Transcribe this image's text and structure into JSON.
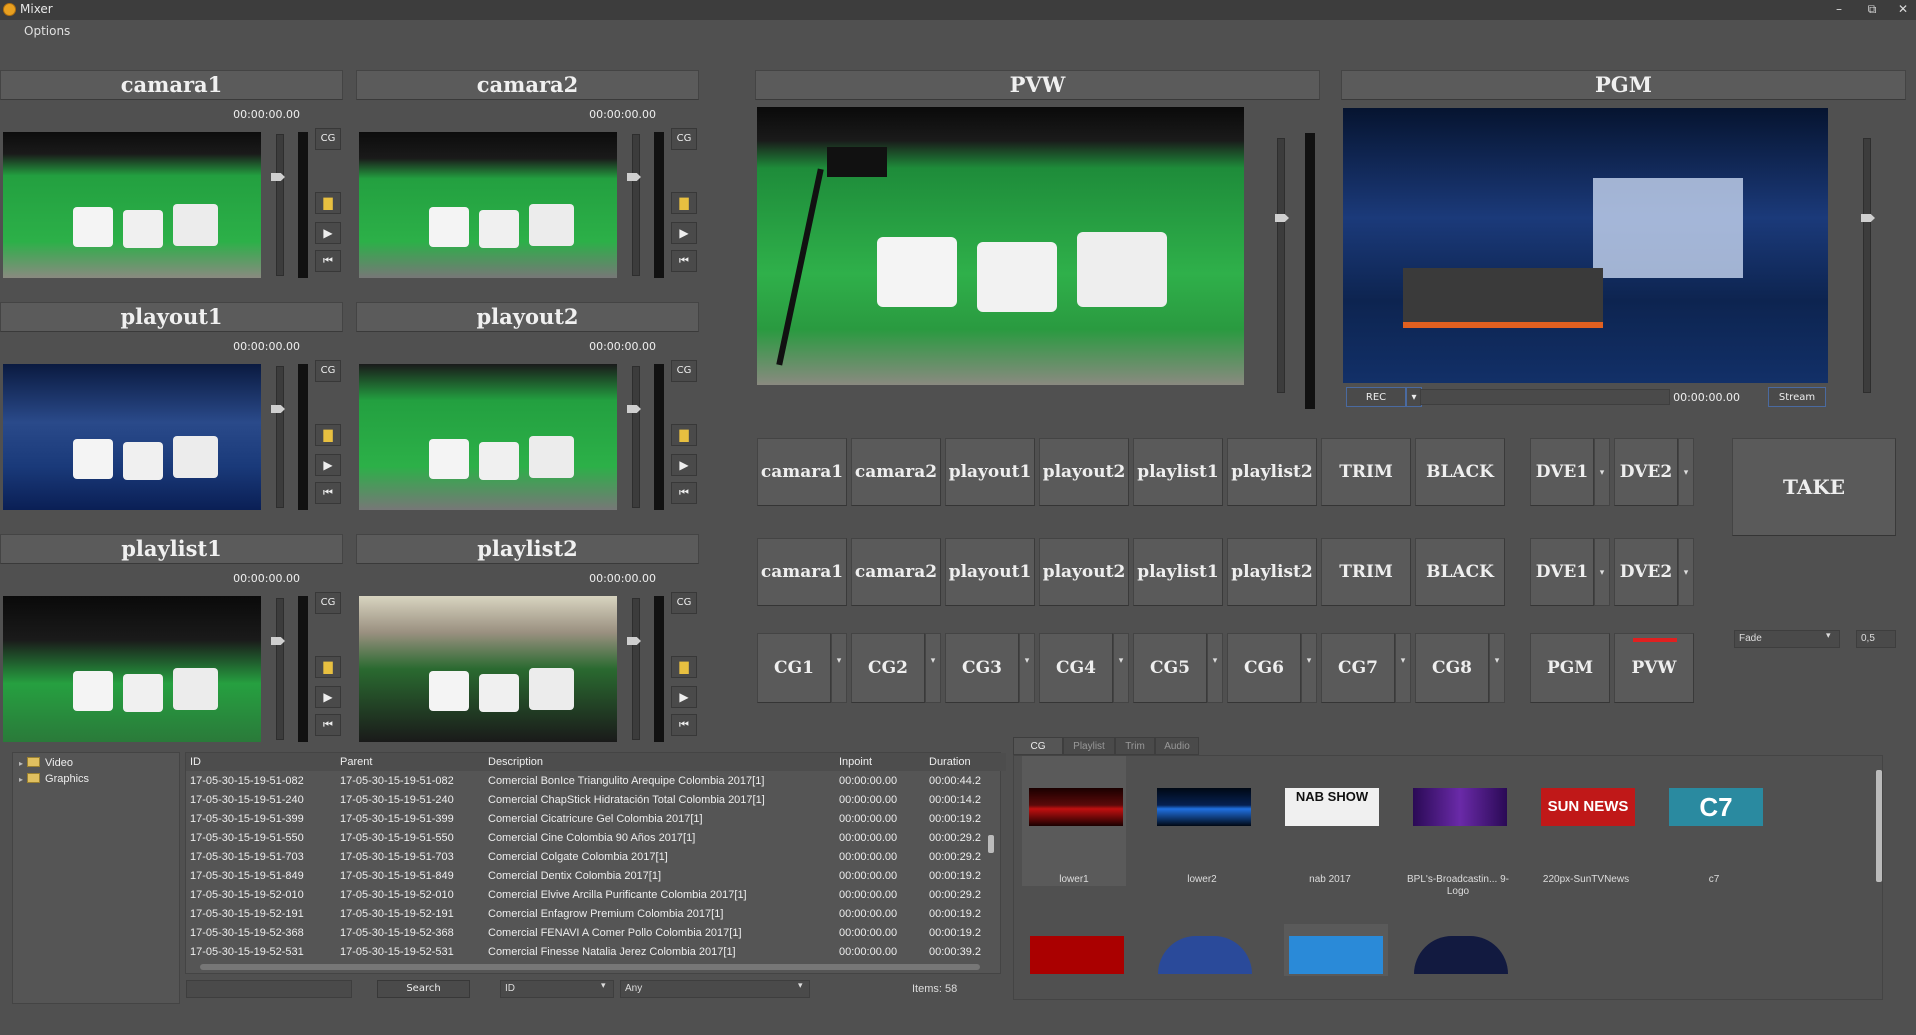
{
  "window": {
    "title": "Mixer",
    "controls": [
      "–",
      "⧉",
      "✕"
    ]
  },
  "menu": {
    "options": "Options"
  },
  "sources": [
    {
      "name": "camara1",
      "time": "00:00:00.00",
      "cg": "CG"
    },
    {
      "name": "camara2",
      "time": "00:00:00.00",
      "cg": "CG"
    },
    {
      "name": "playout1",
      "time": "00:00:00.00",
      "cg": "CG"
    },
    {
      "name": "playout2",
      "time": "00:00:00.00",
      "cg": "CG"
    },
    {
      "name": "playlist1",
      "time": "00:00:00.00",
      "cg": "CG"
    },
    {
      "name": "playlist2",
      "time": "00:00:00.00",
      "cg": "CG"
    }
  ],
  "pvw": {
    "label": "PVW"
  },
  "pgm": {
    "label": "PGM",
    "rec": "REC",
    "time": "00:00:00.00",
    "stream": "Stream"
  },
  "bus_row1": [
    "camara1",
    "camara2",
    "playout1",
    "playout2",
    "playlist1",
    "playlist2",
    "TRIM",
    "BLACK"
  ],
  "bus_row2": [
    "camara1",
    "camara2",
    "playout1",
    "playout2",
    "playlist1",
    "playlist2",
    "TRIM",
    "BLACK"
  ],
  "dve": {
    "dve1": "DVE1",
    "dve2": "DVE2"
  },
  "cg_row": [
    "CG1",
    "CG2",
    "CG3",
    "CG4",
    "CG5",
    "CG6",
    "CG7",
    "CG8"
  ],
  "out": {
    "pgm": "PGM",
    "pvw": "PVW",
    "take": "TAKE"
  },
  "transition": {
    "type": "Fade",
    "duration": "0,5"
  },
  "tree": {
    "video": "Video",
    "graphics": "Graphics"
  },
  "table": {
    "columns": [
      "ID",
      "Parent",
      "Description",
      "Inpoint",
      "Duration"
    ],
    "rows": [
      [
        "17-05-30-15-19-51-082",
        "17-05-30-15-19-51-082",
        "Comercial BonIce Triangulito Arequipe Colombia 2017[1]",
        "00:00:00.00",
        "00:00:44.2"
      ],
      [
        "17-05-30-15-19-51-240",
        "17-05-30-15-19-51-240",
        "Comercial ChapStick Hidratación Total Colombia 2017[1]",
        "00:00:00.00",
        "00:00:14.2"
      ],
      [
        "17-05-30-15-19-51-399",
        "17-05-30-15-19-51-399",
        "Comercial Cicatricure Gel Colombia 2017[1]",
        "00:00:00.00",
        "00:00:19.2"
      ],
      [
        "17-05-30-15-19-51-550",
        "17-05-30-15-19-51-550",
        "Comercial Cine Colombia 90 Años 2017[1]",
        "00:00:00.00",
        "00:00:29.2"
      ],
      [
        "17-05-30-15-19-51-703",
        "17-05-30-15-19-51-703",
        "Comercial Colgate Colombia 2017[1]",
        "00:00:00.00",
        "00:00:29.2"
      ],
      [
        "17-05-30-15-19-51-849",
        "17-05-30-15-19-51-849",
        "Comercial Dentix Colombia 2017[1]",
        "00:00:00.00",
        "00:00:19.2"
      ],
      [
        "17-05-30-15-19-52-010",
        "17-05-30-15-19-52-010",
        "Comercial Elvive Arcilla Purificante Colombia 2017[1]",
        "00:00:00.00",
        "00:00:29.2"
      ],
      [
        "17-05-30-15-19-52-191",
        "17-05-30-15-19-52-191",
        "Comercial Enfagrow Premium Colombia 2017[1]",
        "00:00:00.00",
        "00:00:19.2"
      ],
      [
        "17-05-30-15-19-52-368",
        "17-05-30-15-19-52-368",
        "Comercial FENAVI A Comer Pollo Colombia 2017[1]",
        "00:00:00.00",
        "00:00:19.2"
      ],
      [
        "17-05-30-15-19-52-531",
        "17-05-30-15-19-52-531",
        "Comercial Finesse Natalia Jerez Colombia 2017[1]",
        "00:00:00.00",
        "00:00:39.2"
      ]
    ]
  },
  "search": {
    "button": "Search",
    "field": "ID",
    "filter": "Any",
    "items": "Items: 58"
  },
  "tabs": [
    "CG",
    "Playlist",
    "Trim",
    "Audio"
  ],
  "cg_items": [
    {
      "label": "lower1"
    },
    {
      "label": "lower2"
    },
    {
      "label": "nab 2017",
      "logo": "NAB SHOW"
    },
    {
      "label": "BPL's-Broadcastin... 9-Logo"
    },
    {
      "label": "220px-SunTVNews",
      "logo": "SUN NEWS"
    },
    {
      "label": "c7",
      "logo": "C7"
    }
  ]
}
